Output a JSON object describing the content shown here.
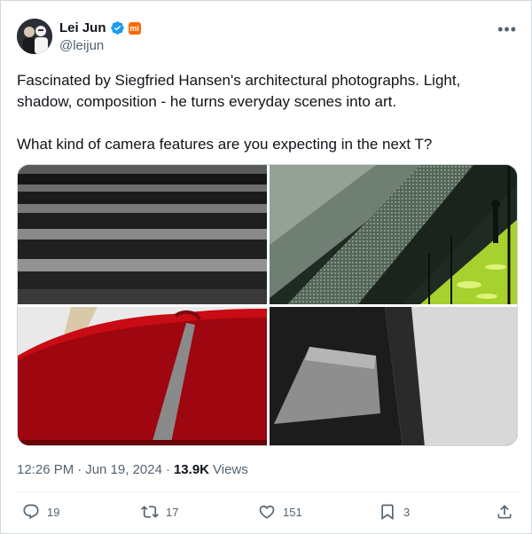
{
  "author": {
    "display_name": "Lei Jun",
    "handle": "@leijun",
    "avatar_icon": "profile-photo",
    "verified_icon": "verified-badge-icon",
    "affiliation_icon": "xiaomi-logo-icon",
    "brand_badge": "mi"
  },
  "tweet": {
    "text_line1": "Fascinated by Siegfried Hansen's architectural photographs. Light, shadow, composition - he turns everyday scenes into art.",
    "text_line2": "What kind of camera features are you expecting in the next T?"
  },
  "media": {
    "photos": [
      {
        "icon": "stairs-photo"
      },
      {
        "icon": "glass-facade-photo"
      },
      {
        "icon": "red-umbrella-photo"
      },
      {
        "icon": "shadow-wall-photo"
      }
    ]
  },
  "meta": {
    "time": "12:26 PM",
    "separator": "·",
    "date": "Jun 19, 2024",
    "separator2": "·",
    "views_count": "13.9K",
    "views_label": "Views"
  },
  "actions": {
    "replies": "19",
    "reposts": "17",
    "likes": "151",
    "bookmarks": "3"
  },
  "colors": {
    "text_primary": "#0f1419",
    "text_secondary": "#536471",
    "verified": "#1d9bf0",
    "brand": "#ff6900"
  }
}
